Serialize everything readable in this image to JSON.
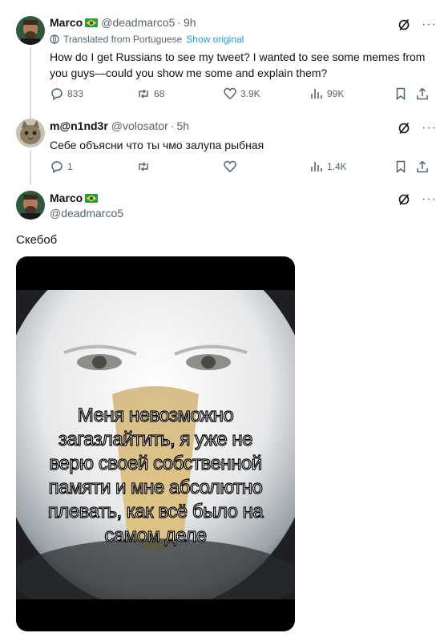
{
  "tweet1": {
    "name": "Marco",
    "handle": "@deadmarco5",
    "time": "9h",
    "translated_label": "Translated from Portuguese",
    "show_original": "Show original",
    "text_line1": "How do I get Russians to see my tweet? I wanted to see some memes from",
    "text_line2": "you guys—could you show me some and explain them?",
    "replies": "833",
    "reposts": "68",
    "likes": "3.9K",
    "views": "99K"
  },
  "tweet2": {
    "name": "m@n1nd3r",
    "handle": "@volosator",
    "time": "5h",
    "text": "Себе объясни что ты чмо залупа рыбная",
    "replies": "1",
    "views": "1.4K"
  },
  "tweet3": {
    "name": "Marco",
    "handle": "@deadmarco5",
    "text": "Скебоб",
    "meme_lines": [
      "Меня невозможно",
      "загазлайтить, я уже не",
      "верю своей собственной",
      "памяти и мне абсолютно",
      "плевать, как всё было на",
      "самом деле"
    ]
  },
  "icons": [
    "grok-icon",
    "more-icon",
    "reply-icon",
    "repost-icon",
    "like-icon",
    "views-icon",
    "bookmark-icon",
    "share-icon",
    "translate-icon",
    "brazil-flag-icon"
  ],
  "colors": {
    "accent": "#1d9bf0",
    "muted": "#536471",
    "text": "#0f1419",
    "line": "#cfd9de"
  }
}
